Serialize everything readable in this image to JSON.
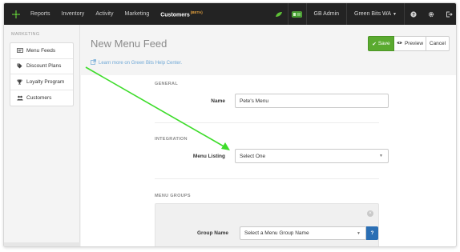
{
  "topnav": {
    "items": [
      "Reports",
      "Inventory",
      "Activity",
      "Marketing"
    ],
    "active_item": "Customers",
    "beta_badge": "(BETA)",
    "user": "GB Admin",
    "store": "Green Bits WA",
    "icons": [
      "leaf-icon",
      "id-card-icon",
      "help-icon",
      "gear-icon",
      "sign-out-icon"
    ]
  },
  "sidebar": {
    "title": "MARKETING",
    "items": [
      {
        "label": "Menu Feeds",
        "icon": "menu-icon"
      },
      {
        "label": "Discount Plans",
        "icon": "tag-icon"
      },
      {
        "label": "Loyalty Program",
        "icon": "trophy-icon"
      },
      {
        "label": "Customers",
        "icon": "users-icon"
      }
    ]
  },
  "header": {
    "title": "New Menu Feed",
    "help_link": "Learn more on Green Bits Help Center.",
    "buttons": {
      "save": "Save",
      "preview": "Preview",
      "cancel": "Cancel"
    }
  },
  "form": {
    "general_label": "GENERAL",
    "name_label": "Name",
    "name_value": "Pete's Menu",
    "integration_label": "INTEGRATION",
    "menu_listing_label": "Menu Listing",
    "menu_listing_value": "Select One",
    "menu_groups_label": "MENU GROUPS",
    "group_name_label": "Group Name",
    "group_name_placeholder": "Select a Menu Group Name",
    "help_glyph": "?"
  },
  "colors": {
    "nav_bg": "#232323",
    "accent_green": "#5aaa2f",
    "link_blue": "#6fa8d6",
    "help_blue": "#2b6fb4",
    "arrow_green": "#3ddc2a"
  }
}
